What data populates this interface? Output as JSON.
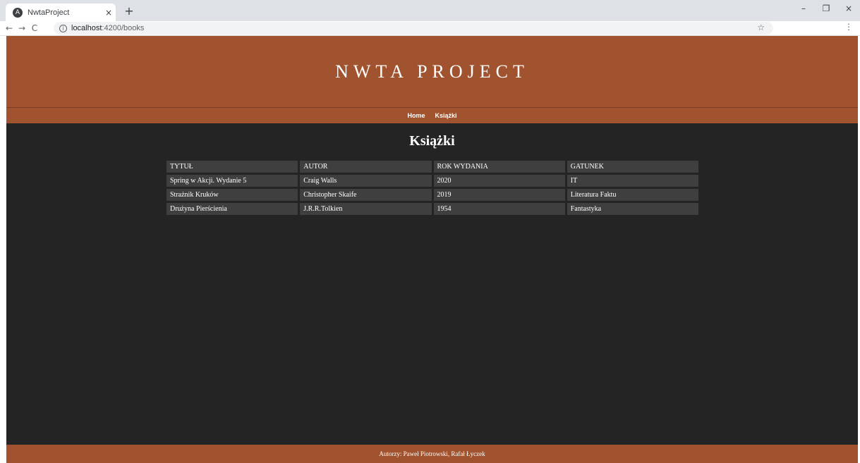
{
  "browser": {
    "tab_title": "NwtaProject",
    "tab_favicon": "A",
    "tab_close": "×",
    "new_tab": "+",
    "url_host": "localhost",
    "url_path": ":4200/books",
    "back": "←",
    "forward": "→",
    "reload": "C",
    "info": "i",
    "star": "☆",
    "menu": "⋮",
    "minimize": "–",
    "restore": "❐",
    "close": "×"
  },
  "header": {
    "title": "NWTA PROJECT"
  },
  "nav": {
    "items": [
      "Home",
      "Książki"
    ]
  },
  "main": {
    "heading": "Książki",
    "table": {
      "columns": [
        "TYTUŁ",
        "AUTOR",
        "ROK WYDANIA",
        "GATUNEK"
      ],
      "rows": [
        [
          "Spring w Akcji. Wydanie 5",
          "Craig Walls",
          "2020",
          "IT"
        ],
        [
          "Strażnik Kruków",
          "Christopher Skaife",
          "2019",
          "Literatura Faktu"
        ],
        [
          "Drużyna Pierścienia",
          "J.R.R.Tolkien",
          "1954",
          "Fantastyka"
        ]
      ]
    }
  },
  "footer": {
    "text": "Autorzy: Paweł Piotrowski, Rafał Łyczek"
  },
  "colors": {
    "brand": "#a0532e",
    "background": "#242424",
    "cell": "#3f3f3f"
  }
}
